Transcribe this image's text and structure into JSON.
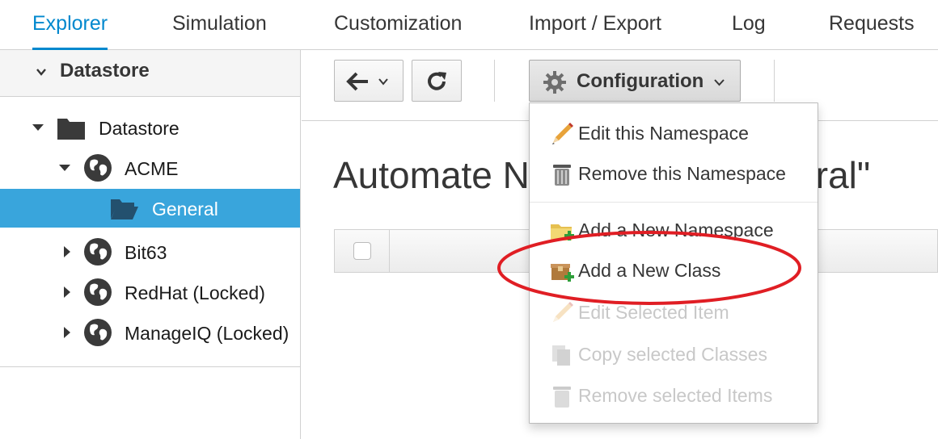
{
  "tabs": [
    {
      "label": "Explorer",
      "active": true
    },
    {
      "label": "Simulation",
      "active": false
    },
    {
      "label": "Customization",
      "active": false
    },
    {
      "label": "Import / Export",
      "active": false
    },
    {
      "label": "Log",
      "active": false
    },
    {
      "label": "Requests",
      "active": false
    }
  ],
  "sidebar": {
    "accordion_title": "Datastore",
    "tree": [
      {
        "label": "Datastore",
        "icon": "folder-icon",
        "expanded": true
      },
      {
        "label": "ACME",
        "icon": "globe-icon",
        "expanded": true
      },
      {
        "label": "General",
        "icon": "folder-open-icon",
        "selected": true
      },
      {
        "label": "Bit63",
        "icon": "globe-icon",
        "expanded": false
      },
      {
        "label": "RedHat (Locked)",
        "icon": "globe-icon",
        "expanded": false
      },
      {
        "label": "ManageIQ (Locked)",
        "icon": "globe-icon",
        "expanded": false
      }
    ]
  },
  "toolbar": {
    "configuration_label": "Configuration"
  },
  "main": {
    "title": "Automate Namespace \"General\""
  },
  "config_menu": {
    "items": [
      {
        "label": "Edit this Namespace",
        "icon": "pencil-icon",
        "disabled": false
      },
      {
        "label": "Remove this Namespace",
        "icon": "trash-icon",
        "disabled": false
      },
      {
        "label": "Add a New Namespace",
        "icon": "folder-add-icon",
        "disabled": false
      },
      {
        "label": "Add a New Class",
        "icon": "box-add-icon",
        "disabled": false
      },
      {
        "label": "Edit Selected Item",
        "icon": "pencil-icon",
        "disabled": true
      },
      {
        "label": "Copy selected Classes",
        "icon": "copy-icon",
        "disabled": true
      },
      {
        "label": "Remove selected Items",
        "icon": "trash-icon",
        "disabled": true
      }
    ]
  },
  "colors": {
    "accent": "#0088ce",
    "selected_row": "#39a5dc",
    "highlight_ring": "#e01e24"
  }
}
